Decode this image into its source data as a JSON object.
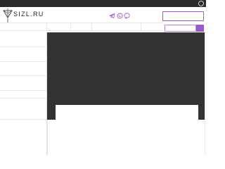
{
  "site": {
    "name": "SIZL.RU"
  },
  "icons": {
    "logo": "triangle-gem-logo-icon",
    "social": [
      "telegram-icon",
      "whatsapp-icon",
      "viber-icon"
    ],
    "search_button": "search-button-icon",
    "window_control": "circle-icon"
  },
  "header": {
    "top_input_value": "",
    "search_input_value": ""
  },
  "colors": {
    "accent": "#9b59d0",
    "topbar": "#2b2b2b",
    "panel": "#333333",
    "text": "#222222"
  }
}
